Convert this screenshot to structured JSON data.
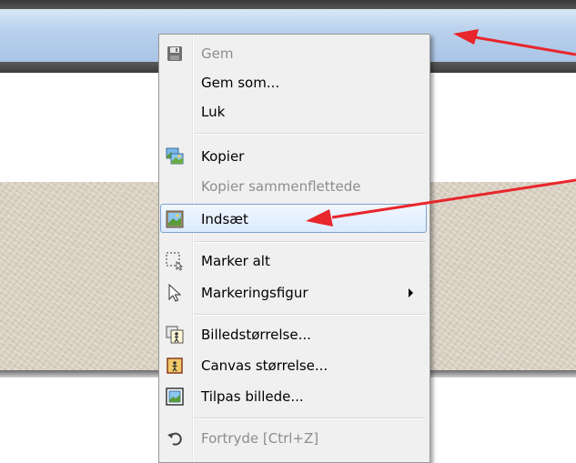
{
  "menu": {
    "items": [
      {
        "label": "Gem",
        "icon": "save-icon",
        "disabled": true
      },
      {
        "label": "Gem som...",
        "disabled": false
      },
      {
        "label": "Luk",
        "disabled": false
      },
      {
        "label": "Kopier",
        "icon": "copy-image-icon",
        "disabled": false
      },
      {
        "label": "Kopier sammenflettede",
        "disabled": true
      },
      {
        "label": "Indsæt",
        "icon": "paste-image-icon",
        "disabled": false,
        "highlighted": true
      },
      {
        "label": "Marker alt",
        "icon": "select-all-icon",
        "disabled": false
      },
      {
        "label": "Markeringsfigur",
        "icon": "cursor-arrow-icon",
        "disabled": false,
        "submenu": true
      },
      {
        "label": "Billedstørrelse...",
        "icon": "image-size-icon",
        "disabled": false
      },
      {
        "label": "Canvas størrelse...",
        "icon": "canvas-size-icon",
        "disabled": false
      },
      {
        "label": "Tilpas billede...",
        "icon": "fit-image-icon",
        "disabled": false
      },
      {
        "label": "Fortryde [Ctrl+Z]",
        "icon": "undo-icon",
        "disabled": true
      }
    ]
  },
  "colors": {
    "annotation_arrow": "#e8262b",
    "highlight_border": "#7da2ce",
    "titlebar": "#b9d1ec"
  }
}
